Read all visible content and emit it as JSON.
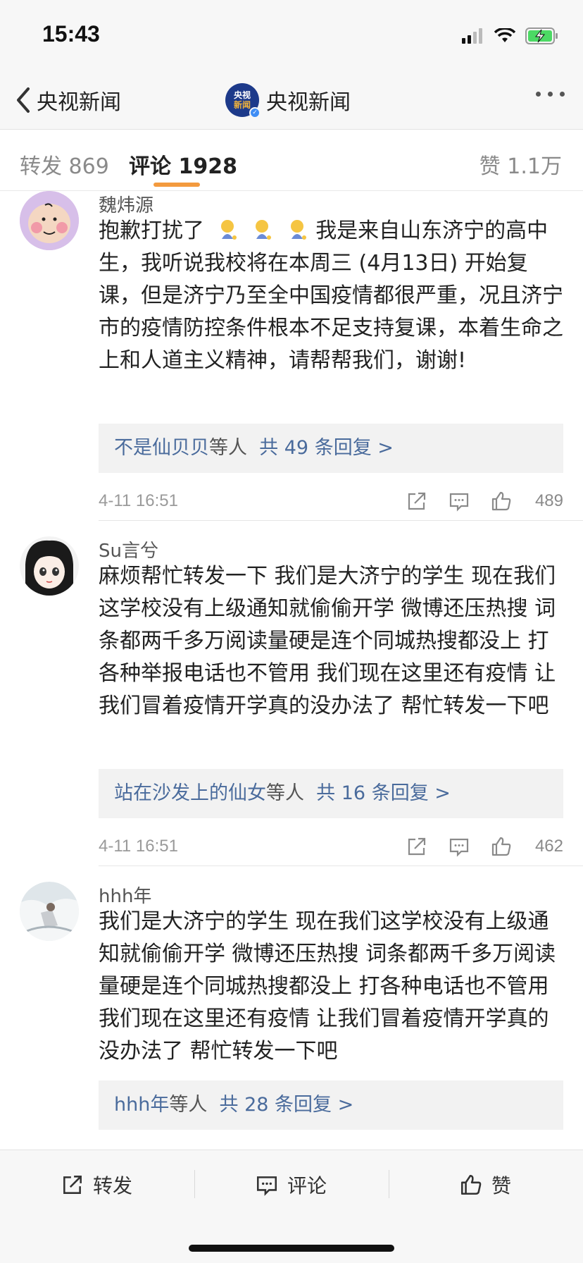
{
  "status_bar": {
    "time": "15:43"
  },
  "nav": {
    "back_label": "央视新闻",
    "logo_line1": "央视",
    "logo_line2": "新闻",
    "title": "央视新闻"
  },
  "tabs": {
    "repost": "转发 869",
    "comment": "评论 1928",
    "like": "赞 1.1万"
  },
  "colors": {
    "accent_orange": "#f39a3e",
    "link_blue": "#4a6b9c",
    "bg_gray": "#f7f7f7"
  },
  "comments": [
    {
      "username": "魏炜源",
      "avatar_icon": "charlie-brown-avatar",
      "content_pre": "抱歉打扰了",
      "emojis": [
        "pray-emoji",
        "pray-emoji",
        "pray-emoji"
      ],
      "content": "我是来自山东济宁的高中生，我听说我校将在本周三 (4月13日) 开始复课，但是济宁乃至全中国疫情都很严重，况且济宁市的疫情防控条件根本不足支持复课，本着生命之上和人道主义精神，请帮帮我们，谢谢!",
      "reply_user": "不是仙贝贝",
      "reply_suffix": "等人",
      "reply_count": "共 49 条回复 >",
      "time": "4-11 16:51",
      "likes": "489"
    },
    {
      "username": "Su言兮",
      "avatar_icon": "anime-girl-avatar",
      "content": "麻烦帮忙转发一下 我们是大济宁的学生 现在我们这学校没有上级通知就偷偷开学 微博还压热搜 词条都两千多万阅读量硬是连个同城热搜都没上 打各种举报电话也不管用 我们现在这里还有疫情 让我们冒着疫情开学真的没办法了 帮忙转发一下吧",
      "reply_user": "站在沙发上的仙女",
      "reply_suffix": "等人",
      "reply_count": "共 16 条回复 >",
      "time": "4-11 16:51",
      "likes": "462"
    },
    {
      "username": "hhh年",
      "avatar_icon": "photo-avatar",
      "content": "我们是大济宁的学生 现在我们这学校没有上级通知就偷偷开学 微博还压热搜 词条都两千多万阅读量硬是连个同城热搜都没上 打各种电话也不管用 我们现在这里还有疫情 让我们冒着疫情开学真的没办法了 帮忙转发一下吧",
      "reply_user": "hhh年",
      "reply_suffix": "等人",
      "reply_count": "共 28 条回复 >"
    }
  ],
  "bottom_bar": {
    "repost": "转发",
    "comment": "评论",
    "like": "赞"
  }
}
